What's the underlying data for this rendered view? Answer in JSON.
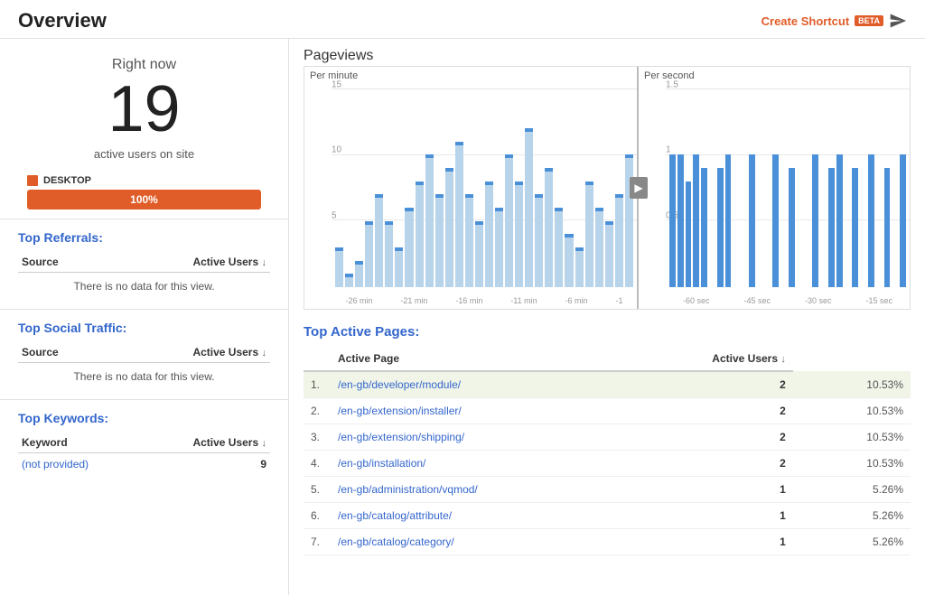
{
  "header": {
    "title": "Overview",
    "create_shortcut_label": "Create Shortcut",
    "beta_label": "BETA"
  },
  "left": {
    "right_now": {
      "label": "Right now",
      "number": "19",
      "sub": "active users on site"
    },
    "device": {
      "label": "DESKTOP",
      "percent": "100%"
    },
    "top_referrals": {
      "title": "Top Referrals:",
      "col1": "Source",
      "col2": "Active Users",
      "empty": "There is no data for this view."
    },
    "top_social": {
      "title": "Top Social Traffic:",
      "col1": "Source",
      "col2": "Active Users",
      "empty": "There is no data for this view."
    },
    "top_keywords": {
      "title": "Top Keywords:",
      "col1": "Keyword",
      "col2": "Active Users",
      "rows": [
        {
          "keyword": "(not provided)",
          "value": "9"
        }
      ]
    }
  },
  "pageviews": {
    "title": "Pageviews",
    "left_label": "Per minute",
    "right_label": "Per second",
    "left_y": [
      "15",
      "10",
      "5"
    ],
    "right_y": [
      "1.5",
      "1",
      "0.5"
    ],
    "left_x": [
      "-26 min",
      "-21 min",
      "-16 min",
      "-11 min",
      "-6 min",
      "-1"
    ],
    "right_x": [
      "-60 sec",
      "-45 sec",
      "-30 sec",
      "-15 sec"
    ],
    "left_bars": [
      3,
      1,
      2,
      5,
      7,
      5,
      3,
      6,
      8,
      10,
      7,
      9,
      11,
      7,
      5,
      8,
      6,
      10,
      8,
      12,
      7,
      9,
      6,
      4,
      3,
      8,
      6,
      5,
      7,
      10
    ],
    "right_bars": [
      1,
      1,
      0.8,
      1,
      0.9,
      0,
      0.9,
      1,
      0,
      0,
      1,
      0,
      0,
      1,
      0,
      0.9,
      0,
      0,
      1,
      0,
      0.9,
      1,
      0,
      0.9,
      0,
      1,
      0,
      0.9,
      0,
      1
    ]
  },
  "active_pages": {
    "title": "Top Active Pages:",
    "col1": "Active Page",
    "col2": "Active Users",
    "rows": [
      {
        "idx": "1.",
        "page": "/en-gb/developer/module/",
        "users": "2",
        "pct": "10.53%",
        "highlight": true
      },
      {
        "idx": "2.",
        "page": "/en-gb/extension/installer/",
        "users": "2",
        "pct": "10.53%",
        "highlight": false
      },
      {
        "idx": "3.",
        "page": "/en-gb/extension/shipping/",
        "users": "2",
        "pct": "10.53%",
        "highlight": false
      },
      {
        "idx": "4.",
        "page": "/en-gb/installation/",
        "users": "2",
        "pct": "10.53%",
        "highlight": false
      },
      {
        "idx": "5.",
        "page": "/en-gb/administration/vqmod/",
        "users": "1",
        "pct": "5.26%",
        "highlight": false
      },
      {
        "idx": "6.",
        "page": "/en-gb/catalog/attribute/",
        "users": "1",
        "pct": "5.26%",
        "highlight": false
      },
      {
        "idx": "7.",
        "page": "/en-gb/catalog/category/",
        "users": "1",
        "pct": "5.26%",
        "highlight": false
      }
    ]
  }
}
